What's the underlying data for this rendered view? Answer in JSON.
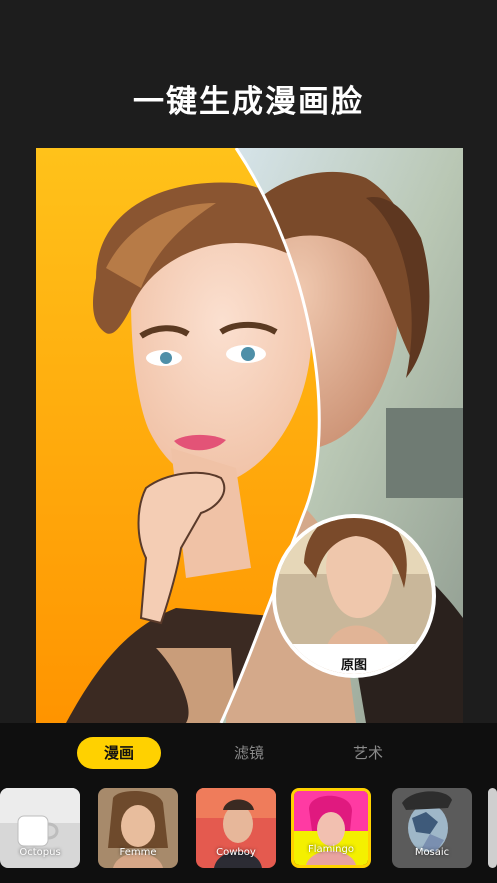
{
  "header": {
    "title": "一键生成漫画脸"
  },
  "preview": {
    "original_badge": "原图"
  },
  "tabs": [
    {
      "label": "漫画",
      "active": true
    },
    {
      "label": "滤镜",
      "active": false
    },
    {
      "label": "艺术",
      "active": false
    }
  ],
  "filters": [
    {
      "label": "Octopus",
      "selected": false
    },
    {
      "label": "Femme",
      "selected": false
    },
    {
      "label": "Cowboy",
      "selected": false
    },
    {
      "label": "Flamingo",
      "selected": true
    },
    {
      "label": "Mosaic",
      "selected": false
    }
  ],
  "colors": {
    "accent": "#ffd100",
    "background": "#1d1d1d",
    "panel": "#0f0f0f"
  }
}
